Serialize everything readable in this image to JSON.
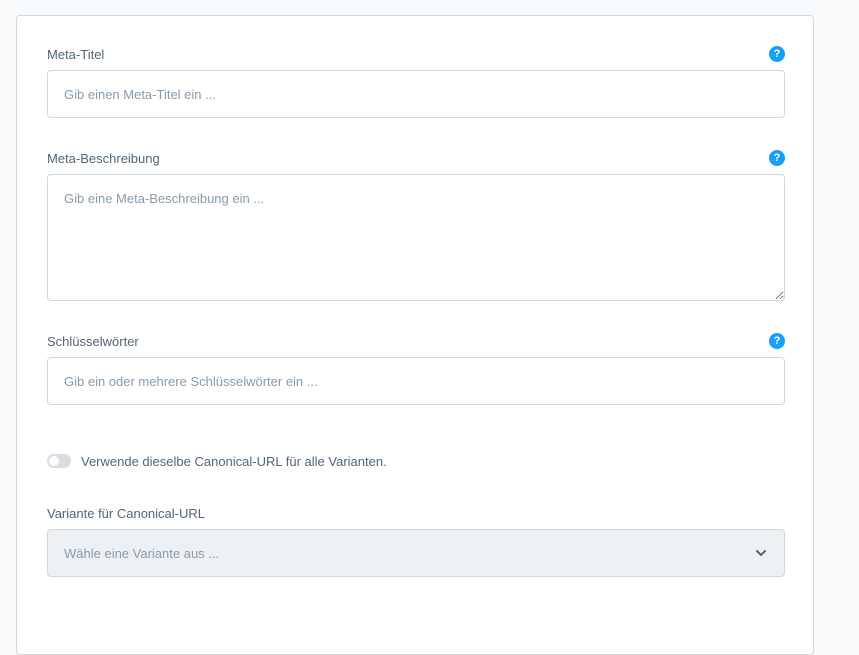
{
  "meta_title": {
    "label": "Meta-Titel",
    "placeholder": "Gib einen Meta-Titel ein ...",
    "help_icon": "question-icon"
  },
  "meta_description": {
    "label": "Meta-Beschreibung",
    "placeholder": "Gib eine Meta-Beschreibung ein ...",
    "help_icon": "question-icon"
  },
  "keywords": {
    "label": "Schlüsselwörter",
    "placeholder": "Gib ein oder mehrere Schlüsselwörter ein ...",
    "help_icon": "question-icon"
  },
  "canonical_toggle": {
    "label": "Verwende dieselbe Canonical-URL für alle Varianten.",
    "checked": false
  },
  "canonical_variant": {
    "label": "Variante für Canonical-URL",
    "placeholder": "Wähle eine Variante aus ...",
    "icon": "chevron-down-icon"
  },
  "colors": {
    "accent": "#189eff",
    "border": "#d1d9e0",
    "disabled_background": "#eef1f4"
  }
}
